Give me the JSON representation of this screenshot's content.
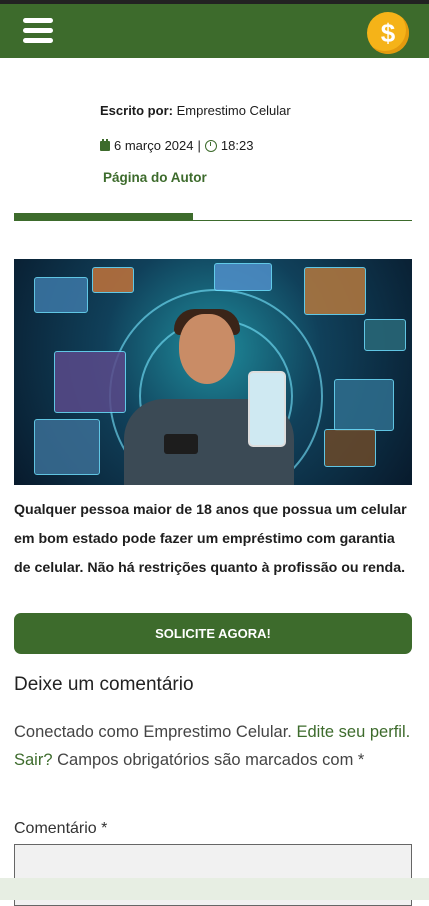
{
  "author": {
    "label": "Escrito por:",
    "name": "Emprestimo Celular",
    "date": "6 março 2024",
    "separator": "|",
    "time": "18:23",
    "page_link": "Página do Autor"
  },
  "reading_progress": 0.45,
  "article": {
    "paragraph": "Qualquer pessoa maior de 18 anos que possua um celular em bom estado pode fazer um empréstimo com garantia de celular. Não há restrições quanto à profissão ou renda.",
    "cta_label": "SOLICITE AGORA!"
  },
  "comments": {
    "title": "Deixe um comentário",
    "logged_in_prefix": "Conectado como Emprestimo Celular. ",
    "edit_profile": "Edite seu perfil.",
    "logout": "Sair?",
    "required_note": " Campos obrigatórios são marcados com *",
    "comment_label": "Comentário *"
  },
  "colors": {
    "brand_green": "#3d6b2c",
    "coin_gold": "#f5b318"
  },
  "icons": {
    "menu": "hamburger-icon",
    "coin": "dollar-coin-icon",
    "calendar": "calendar-icon",
    "clock": "clock-icon"
  },
  "header": {
    "coin_symbol": "$"
  }
}
